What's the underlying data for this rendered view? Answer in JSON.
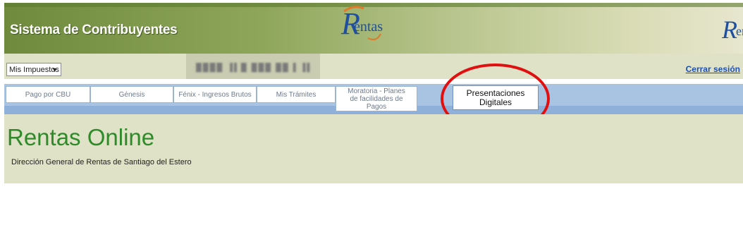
{
  "header": {
    "title": "Sistema de Contribuyentes",
    "logo_text": "entas",
    "logo_right_text": "er",
    "colors": {
      "header_green": "#6f8a3d",
      "title_white": "#ffffff",
      "logo_blue": "#1f4f9e",
      "logo_orange": "#e07a2a"
    }
  },
  "toolbar": {
    "select_value": "Mis Impuestos",
    "blurred_user": "████ ▐▌█ ███  ██ ▌▐▌",
    "logout_label": "Cerrar sesión"
  },
  "nav": {
    "tabs": [
      {
        "label": "Pago por CBU"
      },
      {
        "label": "Génesis"
      },
      {
        "label": "Fénix - Ingresos Brutos"
      },
      {
        "label": "Mis Trámites"
      },
      {
        "label": "Moratoria - Planes de facilidades de Pagos"
      },
      {
        "label": "Presentaciones Digitales"
      }
    ],
    "colors": {
      "nav_blue": "#a9c4e2",
      "highlight_circle": "#e11010"
    }
  },
  "main": {
    "title": "Rentas Online",
    "subtitle": "Dirección General de Rentas de Santiago del Estero",
    "colors": {
      "title_green": "#2f8a2a",
      "panel_bg": "#dfe2c6"
    }
  }
}
